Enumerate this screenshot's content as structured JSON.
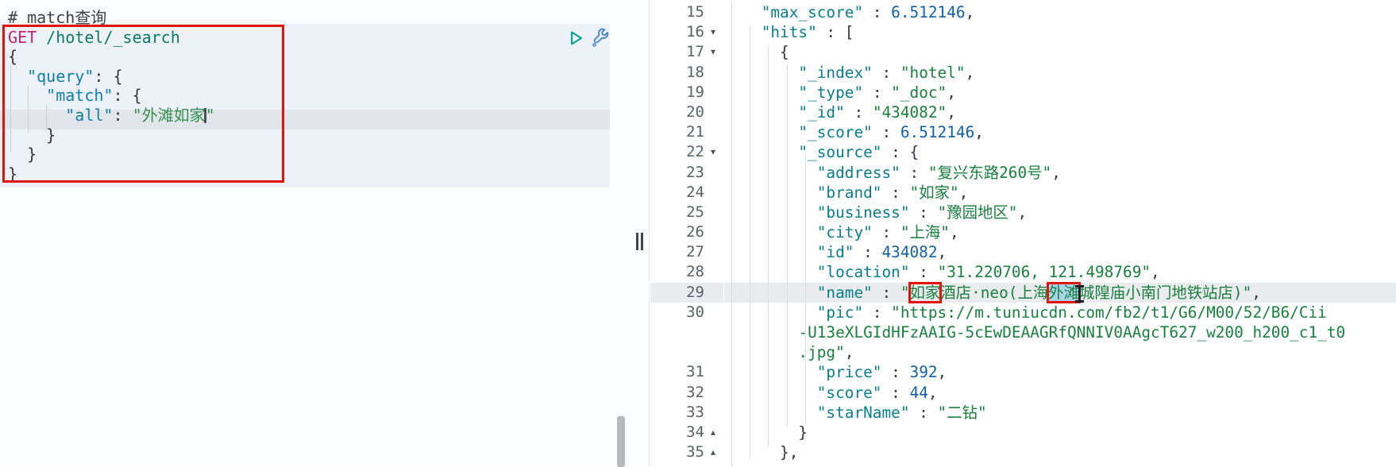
{
  "app": "kibana-dev-tools-console",
  "colors": {
    "annotation_red": "#e01408",
    "selection_blue": "#a9d3e9",
    "request_block_bg": "#edf1f8",
    "current_line_bg": "#e2e6ea",
    "response_highlight_row_bg": "#e9ebee",
    "key_teal": "#077e8c",
    "string_green": "#17813d",
    "number_blue": "#1261a8",
    "method_magenta": "#c2256b"
  },
  "editor": {
    "comment": "# match查询",
    "method": "GET",
    "endpoint": "/hotel/_search",
    "query_value": "外滩如家",
    "rows": [
      {
        "segments": [
          {
            "t": "# match查询",
            "c": "cm"
          }
        ]
      },
      {
        "segments": [
          {
            "t": "GET",
            "c": "m"
          },
          {
            "t": " ",
            "c": "p"
          },
          {
            "t": "/hotel/_search",
            "c": "u"
          }
        ]
      },
      {
        "segments": [
          {
            "t": "{",
            "c": "p"
          }
        ]
      },
      {
        "segments": [
          {
            "t": "  ",
            "c": "p"
          },
          {
            "t": "\"query\"",
            "c": "ek"
          },
          {
            "t": ": {",
            "c": "p"
          }
        ]
      },
      {
        "segments": [
          {
            "t": "    ",
            "c": "p"
          },
          {
            "t": "\"match\"",
            "c": "ek"
          },
          {
            "t": ": {",
            "c": "p"
          }
        ]
      },
      {
        "segments": [
          {
            "t": "      ",
            "c": "p"
          },
          {
            "t": "\"all\"",
            "c": "ek"
          },
          {
            "t": ": ",
            "c": "p"
          },
          {
            "t": "\"外滩如家",
            "c": "gs"
          },
          {
            "t": "",
            "c": "caret"
          },
          {
            "t": "\"",
            "c": "gs"
          }
        ]
      },
      {
        "segments": [
          {
            "t": "    }",
            "c": "p"
          }
        ]
      },
      {
        "segments": [
          {
            "t": "  }",
            "c": "p"
          }
        ]
      },
      {
        "segments": [
          {
            "t": "}",
            "c": "p"
          }
        ]
      }
    ]
  },
  "response": {
    "rows": [
      {
        "num": "15",
        "fold": "",
        "highlight": false,
        "segments": [
          {
            "t": "    ",
            "c": "p"
          },
          {
            "t": "\"max_score\"",
            "c": "k"
          },
          {
            "t": " : ",
            "c": "p"
          },
          {
            "t": "6.512146",
            "c": "n"
          },
          {
            "t": ",",
            "c": "p"
          }
        ]
      },
      {
        "num": "16",
        "fold": "open",
        "highlight": false,
        "segments": [
          {
            "t": "    ",
            "c": "p"
          },
          {
            "t": "\"hits\"",
            "c": "k"
          },
          {
            "t": " : [",
            "c": "p"
          }
        ]
      },
      {
        "num": "17",
        "fold": "open",
        "highlight": false,
        "segments": [
          {
            "t": "      {",
            "c": "p"
          }
        ]
      },
      {
        "num": "18",
        "fold": "",
        "highlight": false,
        "segments": [
          {
            "t": "        ",
            "c": "p"
          },
          {
            "t": "\"_index\"",
            "c": "k"
          },
          {
            "t": " : ",
            "c": "p"
          },
          {
            "t": "\"hotel\"",
            "c": "s"
          },
          {
            "t": ",",
            "c": "p"
          }
        ]
      },
      {
        "num": "19",
        "fold": "",
        "highlight": false,
        "segments": [
          {
            "t": "        ",
            "c": "p"
          },
          {
            "t": "\"_type\"",
            "c": "k"
          },
          {
            "t": " : ",
            "c": "p"
          },
          {
            "t": "\"_doc\"",
            "c": "s"
          },
          {
            "t": ",",
            "c": "p"
          }
        ]
      },
      {
        "num": "20",
        "fold": "",
        "highlight": false,
        "segments": [
          {
            "t": "        ",
            "c": "p"
          },
          {
            "t": "\"_id\"",
            "c": "k"
          },
          {
            "t": " : ",
            "c": "p"
          },
          {
            "t": "\"434082\"",
            "c": "s"
          },
          {
            "t": ",",
            "c": "p"
          }
        ]
      },
      {
        "num": "21",
        "fold": "",
        "highlight": false,
        "segments": [
          {
            "t": "        ",
            "c": "p"
          },
          {
            "t": "\"_score\"",
            "c": "k"
          },
          {
            "t": " : ",
            "c": "p"
          },
          {
            "t": "6.512146",
            "c": "n"
          },
          {
            "t": ",",
            "c": "p"
          }
        ]
      },
      {
        "num": "22",
        "fold": "open",
        "highlight": false,
        "segments": [
          {
            "t": "        ",
            "c": "p"
          },
          {
            "t": "\"_source\"",
            "c": "k"
          },
          {
            "t": " : {",
            "c": "p"
          }
        ]
      },
      {
        "num": "23",
        "fold": "",
        "highlight": false,
        "segments": [
          {
            "t": "          ",
            "c": "p"
          },
          {
            "t": "\"address\"",
            "c": "k"
          },
          {
            "t": " : ",
            "c": "p"
          },
          {
            "t": "\"复兴东路260号\"",
            "c": "s"
          },
          {
            "t": ",",
            "c": "p"
          }
        ]
      },
      {
        "num": "24",
        "fold": "",
        "highlight": false,
        "segments": [
          {
            "t": "          ",
            "c": "p"
          },
          {
            "t": "\"brand\"",
            "c": "k"
          },
          {
            "t": " : ",
            "c": "p"
          },
          {
            "t": "\"如家\"",
            "c": "s"
          },
          {
            "t": ",",
            "c": "p"
          }
        ]
      },
      {
        "num": "25",
        "fold": "",
        "highlight": false,
        "segments": [
          {
            "t": "          ",
            "c": "p"
          },
          {
            "t": "\"business\"",
            "c": "k"
          },
          {
            "t": " : ",
            "c": "p"
          },
          {
            "t": "\"豫园地区\"",
            "c": "s"
          },
          {
            "t": ",",
            "c": "p"
          }
        ]
      },
      {
        "num": "26",
        "fold": "",
        "highlight": false,
        "segments": [
          {
            "t": "          ",
            "c": "p"
          },
          {
            "t": "\"city\"",
            "c": "k"
          },
          {
            "t": " : ",
            "c": "p"
          },
          {
            "t": "\"上海\"",
            "c": "s"
          },
          {
            "t": ",",
            "c": "p"
          }
        ]
      },
      {
        "num": "27",
        "fold": "",
        "highlight": false,
        "segments": [
          {
            "t": "          ",
            "c": "p"
          },
          {
            "t": "\"id\"",
            "c": "k"
          },
          {
            "t": " : ",
            "c": "p"
          },
          {
            "t": "434082",
            "c": "n"
          },
          {
            "t": ",",
            "c": "p"
          }
        ]
      },
      {
        "num": "28",
        "fold": "",
        "highlight": false,
        "segments": [
          {
            "t": "          ",
            "c": "p"
          },
          {
            "t": "\"location\"",
            "c": "k"
          },
          {
            "t": " : ",
            "c": "p"
          },
          {
            "t": "\"31.220706, 121.498769\"",
            "c": "s"
          },
          {
            "t": ",",
            "c": "p"
          }
        ]
      },
      {
        "num": "29",
        "fold": "",
        "highlight": true,
        "segments": [
          {
            "t": "          ",
            "c": "p"
          },
          {
            "t": "\"name\"",
            "c": "k"
          },
          {
            "t": " : ",
            "c": "p"
          },
          {
            "t": "\"",
            "c": "s"
          },
          {
            "t": "如家",
            "c": "s rbox"
          },
          {
            "t": "酒店·neo(上海",
            "c": "s"
          },
          {
            "t": "外滩",
            "c": "s rsel"
          },
          {
            "t": "",
            "c": "ibeam"
          },
          {
            "t": "城隍庙小南门地铁站店)\"",
            "c": "s"
          },
          {
            "t": ",",
            "c": "p"
          }
        ]
      },
      {
        "num": "30",
        "fold": "",
        "highlight": false,
        "segments": [
          {
            "t": "          ",
            "c": "p"
          },
          {
            "t": "\"pic\"",
            "c": "k"
          },
          {
            "t": " : ",
            "c": "p"
          },
          {
            "t": "\"https://m.tuniucdn.com/fb2/t1/G6/M00/52/B6/Cii",
            "c": "s"
          }
        ]
      },
      {
        "num": "",
        "fold": "",
        "highlight": false,
        "segments": [
          {
            "t": "        ",
            "c": "p"
          },
          {
            "t": "-U13eXLGIdHFzAAIG-5cEwDEAAGRfQNNIV0AAgcT627_w200_h200_c1_t0",
            "c": "s"
          }
        ]
      },
      {
        "num": "",
        "fold": "",
        "highlight": false,
        "segments": [
          {
            "t": "        ",
            "c": "p"
          },
          {
            "t": ".jpg\"",
            "c": "s"
          },
          {
            "t": ",",
            "c": "p"
          }
        ]
      },
      {
        "num": "31",
        "fold": "",
        "highlight": false,
        "segments": [
          {
            "t": "          ",
            "c": "p"
          },
          {
            "t": "\"price\"",
            "c": "k"
          },
          {
            "t": " : ",
            "c": "p"
          },
          {
            "t": "392",
            "c": "n"
          },
          {
            "t": ",",
            "c": "p"
          }
        ]
      },
      {
        "num": "32",
        "fold": "",
        "highlight": false,
        "segments": [
          {
            "t": "          ",
            "c": "p"
          },
          {
            "t": "\"score\"",
            "c": "k"
          },
          {
            "t": " : ",
            "c": "p"
          },
          {
            "t": "44",
            "c": "n"
          },
          {
            "t": ",",
            "c": "p"
          }
        ]
      },
      {
        "num": "33",
        "fold": "",
        "highlight": false,
        "segments": [
          {
            "t": "          ",
            "c": "p"
          },
          {
            "t": "\"starName\"",
            "c": "k"
          },
          {
            "t": " : ",
            "c": "p"
          },
          {
            "t": "\"二钻\"",
            "c": "s"
          }
        ]
      },
      {
        "num": "34",
        "fold": "close",
        "highlight": false,
        "segments": [
          {
            "t": "        }",
            "c": "p"
          }
        ]
      },
      {
        "num": "35",
        "fold": "close",
        "highlight": false,
        "segments": [
          {
            "t": "      },",
            "c": "p"
          }
        ]
      }
    ]
  },
  "glyphs": {
    "fold_open": "▾",
    "fold_close": "▴"
  }
}
